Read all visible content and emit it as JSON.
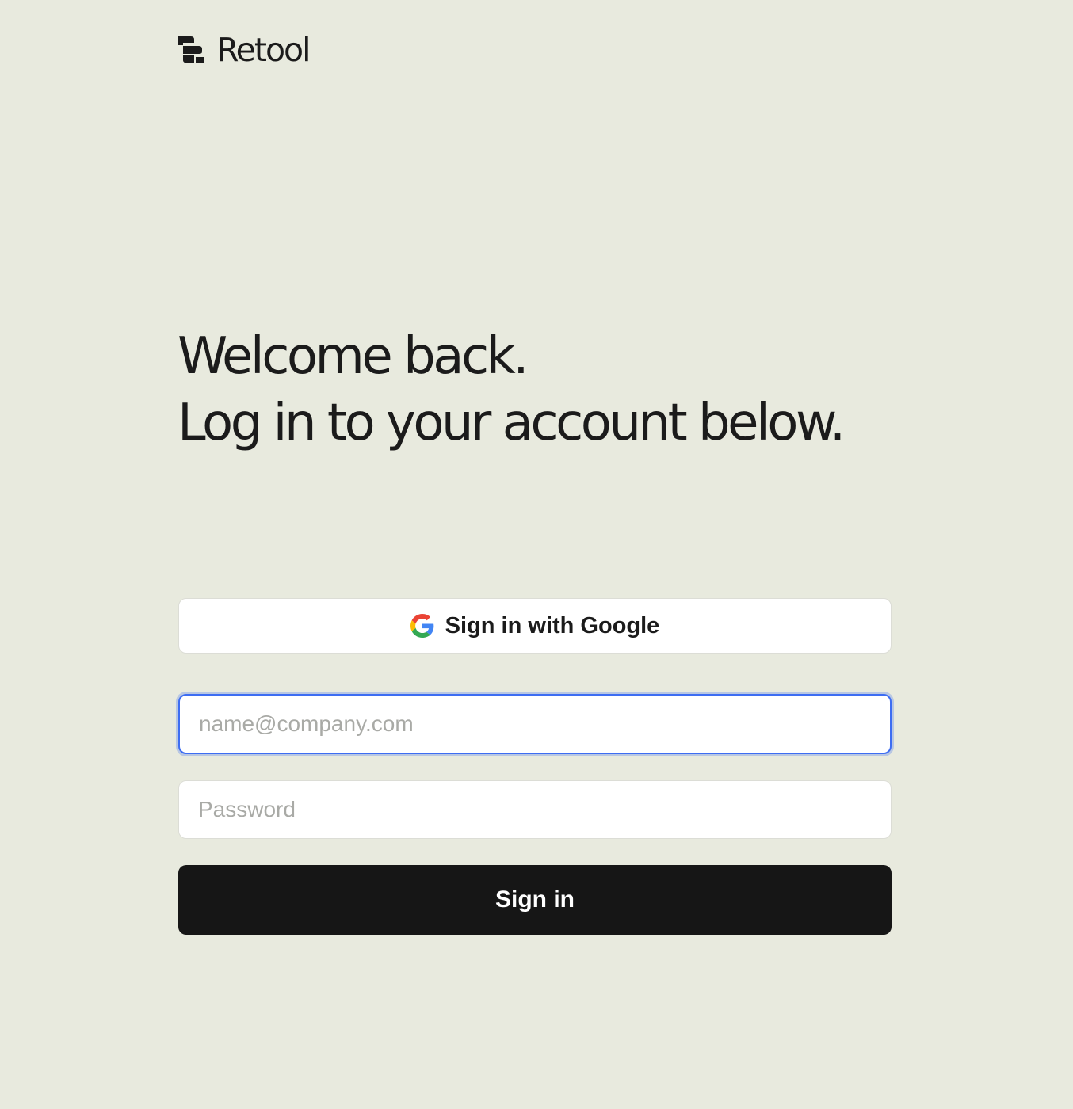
{
  "brand": {
    "name": "Retool",
    "logo_icon": "retool-logo-icon"
  },
  "headline": {
    "line1": "Welcome back.",
    "line2": "Log in to your account below."
  },
  "google_button": {
    "label": "Sign in with Google",
    "icon": "google-icon"
  },
  "email_field": {
    "value": "",
    "placeholder": "name@company.com"
  },
  "password_field": {
    "value": "",
    "placeholder": "Password"
  },
  "signin_button": {
    "label": "Sign in"
  },
  "colors": {
    "background": "#e8eade",
    "text": "#1b1b1b",
    "primary_button": "#161616",
    "focus_ring": "#3d6df2"
  }
}
